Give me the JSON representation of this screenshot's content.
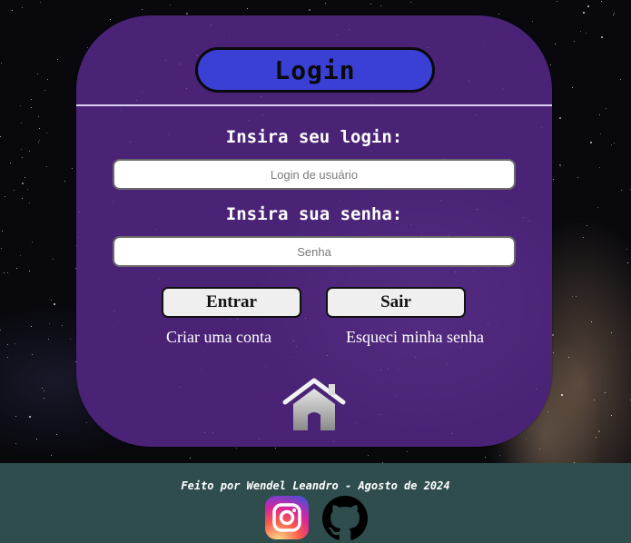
{
  "card": {
    "title": "Login",
    "login_label": "Insira seu login:",
    "login_placeholder": "Login de usuário",
    "password_label": "Insira sua senha:",
    "password_placeholder": "Senha",
    "enter_button": "Entrar",
    "exit_button": "Sair",
    "create_account_link": "Criar uma conta",
    "forgot_password_link": "Esqueci minha senha",
    "home_icon": "home-icon"
  },
  "footer": {
    "credit": "Feito por Wendel Leandro - Agosto de 2024",
    "instagram_icon": "instagram-icon",
    "github_icon": "github-icon"
  },
  "colors": {
    "card_bg": "#4a2377",
    "title_bg": "#3a3fd6",
    "footer_bg": "#2f4d4d"
  }
}
